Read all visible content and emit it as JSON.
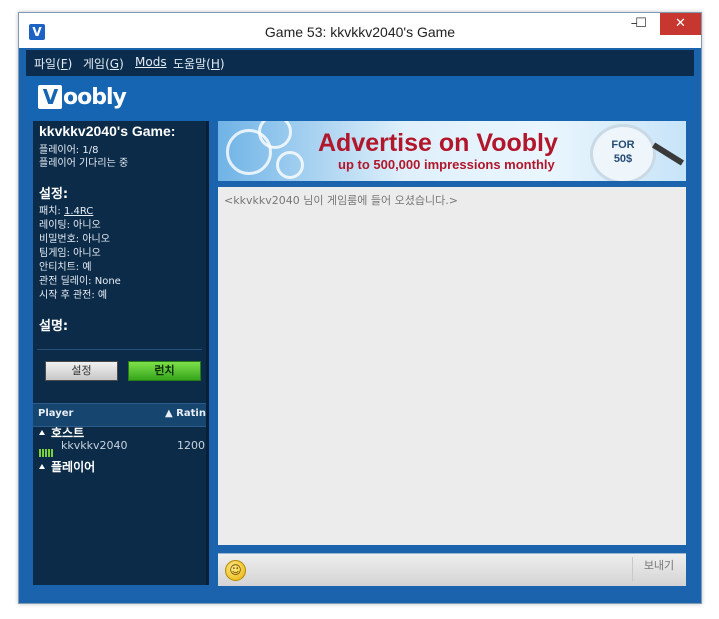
{
  "window": {
    "title": "Game 53: kkvkkv2040's Game",
    "app_icon": "V",
    "minimize_icon": "–",
    "maximize_icon": "☐",
    "close_icon": "✕"
  },
  "menu": {
    "items": [
      {
        "label": "파일(",
        "key": "F",
        "suffix": ")"
      },
      {
        "label": "게임(",
        "key": "G",
        "suffix": ")"
      },
      {
        "label": "",
        "key": "Mods",
        "suffix": ""
      },
      {
        "label": "도움말(",
        "key": "H",
        "suffix": ")"
      }
    ]
  },
  "brand": {
    "logo_v": "V",
    "logo_rest": "oobly"
  },
  "game": {
    "title": "kkvkkv2040's Game:",
    "players": "플레이어: 1/8",
    "status": "플레이어 기다리는 중"
  },
  "settings": {
    "heading": "설정:",
    "patch_label": "패치: ",
    "patch_value": "1.4RC",
    "rated": "레이팅: 아니오",
    "password": "비밀번호: 아니오",
    "team_game": "팀게임: 아니오",
    "anti_cheat": "안티치트: 예",
    "spectate_delay": "관전 딜레이: None",
    "spectate_after_start": "시작 후 관전: 예"
  },
  "description": {
    "heading": "설명:"
  },
  "buttons": {
    "settings": "설정",
    "launch": "런치"
  },
  "player_list": {
    "col_player": "Player",
    "col_rating": "▲ Ratin",
    "host_group": "호스트",
    "players_group": "플레이어",
    "rows": [
      {
        "name": "kkvkkv2040",
        "rating": "1200"
      }
    ]
  },
  "ad": {
    "headline": "Advertise on Voobly",
    "subline": "up to 500,000 impressions monthly",
    "badge_line1": "FOR",
    "badge_line2": "50$"
  },
  "chat": {
    "messages": [
      "<kkvkkv2040 님이 게임룸에 들어 오셨습니다.>"
    ],
    "input_value": "",
    "send_label": "보내기",
    "emoji_icon": "☺"
  },
  "colors": {
    "frame_blue": "#1b63ad",
    "panel_dark": "#0b2b48",
    "launch_green": "#35a51b",
    "ad_red": "#b2162b"
  }
}
